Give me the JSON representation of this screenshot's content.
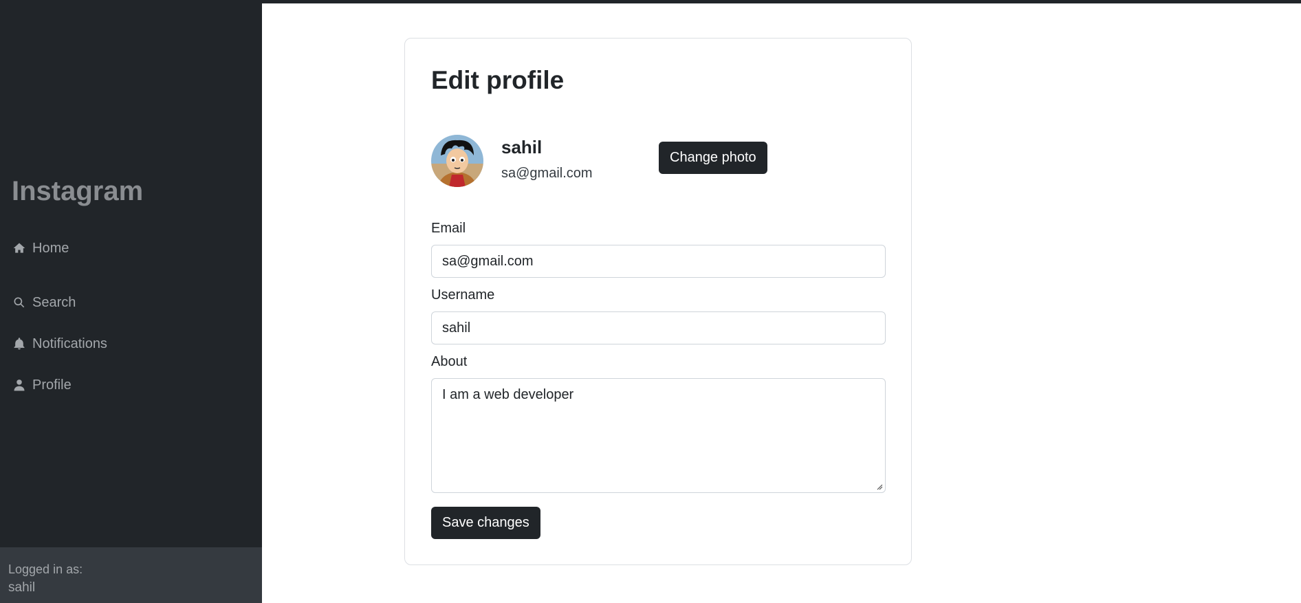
{
  "sidebar": {
    "brand": "Instagram",
    "items": [
      {
        "label": "Home",
        "icon": "home-icon"
      },
      {
        "label": "Search",
        "icon": "search-icon"
      },
      {
        "label": "Notifications",
        "icon": "bell-icon"
      },
      {
        "label": "Profile",
        "icon": "user-icon"
      }
    ],
    "footer": {
      "label": "Logged in as:",
      "user": "sahil"
    }
  },
  "card": {
    "title": "Edit profile",
    "profile": {
      "username": "sahil",
      "email": "sa@gmail.com",
      "change_photo_label": "Change photo"
    },
    "form": {
      "email_label": "Email",
      "email_value": "sa@gmail.com",
      "username_label": "Username",
      "username_value": "sahil",
      "about_label": "About",
      "about_value": "I am a web developer",
      "save_label": "Save changes"
    }
  },
  "colors": {
    "sidebar_bg": "#212529",
    "footer_bg": "#353a40",
    "button_bg": "#212529"
  }
}
